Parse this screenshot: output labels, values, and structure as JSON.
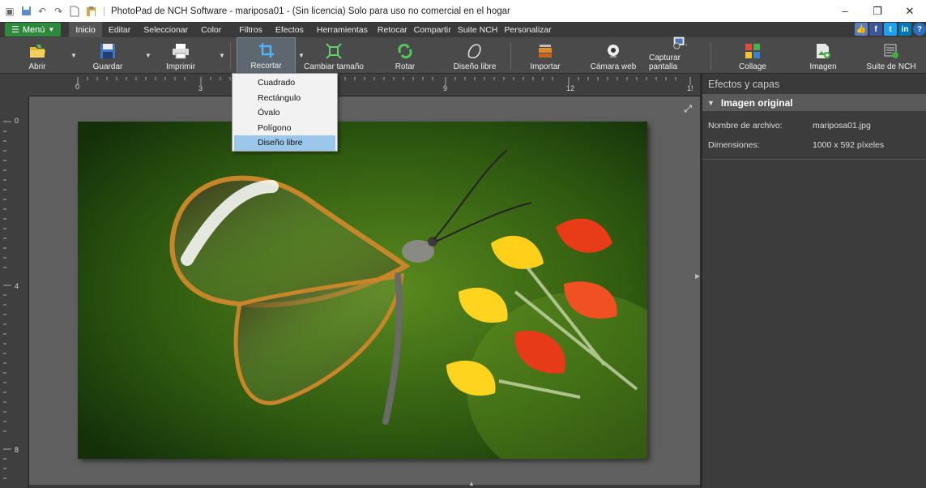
{
  "window": {
    "title": "PhotoPad de NCH Software - mariposa01 - (Sin licencia) Solo para uso no comercial en el hogar",
    "minimize": "–",
    "restore": "❐",
    "close": "✕"
  },
  "menu": {
    "menu_label": "Menú",
    "tabs": [
      "Inicio",
      "Editar",
      "Seleccionar",
      "Color",
      "Filtros",
      "Efectos",
      "Herramientas",
      "Retocar",
      "Compartir",
      "Suite NCH",
      "Personalizar"
    ],
    "active_tab": "Inicio"
  },
  "social": [
    "👍",
    "f",
    "t",
    "in",
    "?"
  ],
  "toolbar": {
    "abrir": "Abrir",
    "guardar": "Guardar",
    "imprimir": "Imprimir",
    "recortar": "Recortar",
    "cambiar": "Cambiar tamaño",
    "rotar": "Rotar",
    "diseno": "Diseño libre",
    "importar": "Importar",
    "camara": "Cámara web",
    "capturar": "Capturar pantalla",
    "collage": "Collage",
    "imagen": "Imagen",
    "suite": "Suite de NCH"
  },
  "ruler": {
    "h_labels": [
      "0",
      "3",
      "9",
      "12",
      "1!"
    ],
    "v_labels": [
      "0",
      "4",
      "8"
    ]
  },
  "crop_menu": {
    "items": [
      "Cuadrado",
      "Rectángulo",
      "Óvalo",
      "Polígono",
      "Diseño libre"
    ],
    "selected": "Diseño libre"
  },
  "panel": {
    "title": "Efectos y capas",
    "layer": "Imagen original",
    "file_label": "Nombre de archivo:",
    "file_value": "mariposa01.jpg",
    "dim_label": "Dimensiones:",
    "dim_value": "1000 x 592 píxeles"
  },
  "colors": {
    "menu_green": "#2d8a3c",
    "toolbar_bg": "#4a4a4a",
    "canvas_bg": "#606060",
    "selected_item": "#9bc7ea"
  }
}
